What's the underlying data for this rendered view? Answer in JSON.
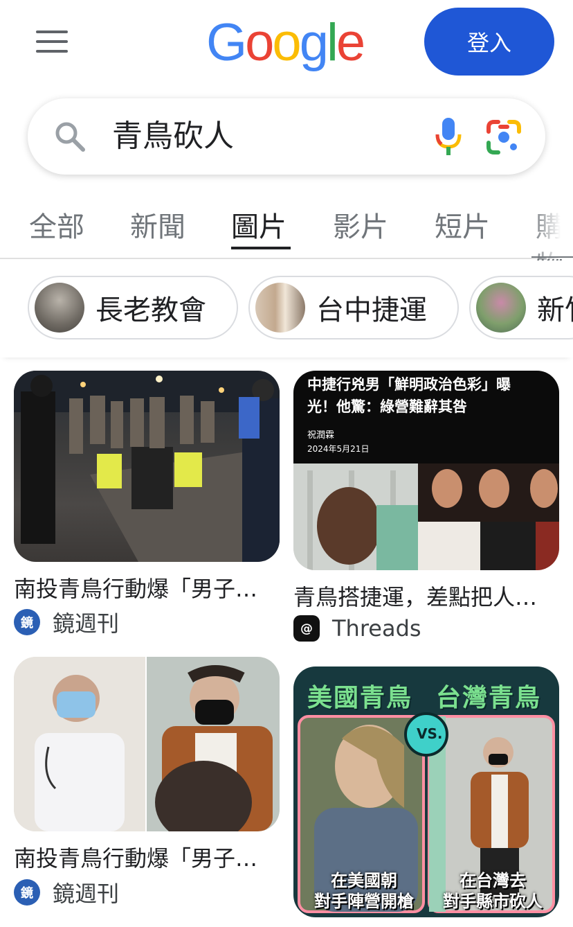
{
  "header": {
    "logo_text": "Google",
    "signin_label": "登入"
  },
  "search": {
    "query": "青鳥砍人"
  },
  "tabs": [
    {
      "label": "全部",
      "active": false
    },
    {
      "label": "新聞",
      "active": false
    },
    {
      "label": "圖片",
      "active": true
    },
    {
      "label": "影片",
      "active": false
    },
    {
      "label": "短片",
      "active": false
    },
    {
      "label": "購物",
      "active": false
    }
  ],
  "chips": [
    {
      "label": "長老教會"
    },
    {
      "label": "台中捷運"
    },
    {
      "label": "新竹"
    }
  ],
  "results": [
    {
      "title": "南投青鳥行動爆「男子…",
      "source": "鏡週刊",
      "icon": "mirror-media-icon"
    },
    {
      "title": "青鳥搭捷運，差點把人…",
      "source": "Threads",
      "icon": "threads-icon",
      "image_text": {
        "headline_1": "中捷行兇男「鮮明政治色彩」曝",
        "headline_2": "光！他驚：綠營難辭其咎",
        "author": "祝潤霖",
        "date": "2024年5月21日"
      }
    },
    {
      "title": "南投青鳥行動爆「男子…",
      "source": "鏡週刊",
      "icon": "mirror-media-icon"
    },
    {
      "title": "",
      "source": "",
      "icon": "",
      "image_text": {
        "left_title": "美國青鳥",
        "right_title": "台灣青鳥",
        "vs": "VS.",
        "left_caption_1": "在美國朝",
        "left_caption_2": "對手陣營開槍",
        "right_caption_1": "在台灣去",
        "right_caption_2": "對手縣市砍人"
      }
    }
  ],
  "colors": {
    "signin_bg": "#1f57d6",
    "text_primary": "#202124",
    "text_secondary": "#70757a"
  }
}
